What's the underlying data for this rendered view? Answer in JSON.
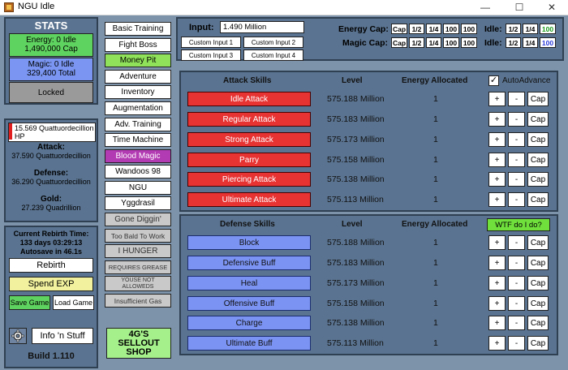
{
  "window": {
    "title": "NGU Idle",
    "minimize": "—",
    "maximize": "☐",
    "close": "✕"
  },
  "stats": {
    "header": "STATS",
    "energy_line1": "Energy: 0 Idle",
    "energy_line2": "1,490,000 Cap",
    "magic_line1": "Magic: 0 Idle",
    "magic_line2": "329,400 Total",
    "locked": "Locked",
    "hp_line1": "15.569 Quattuordecillion",
    "hp_line2": "HP",
    "attack_label": "Attack:",
    "attack_value": "37.590 Quattuordecillion",
    "defense_label": "Defense:",
    "defense_value": "36.290 Quattuordecillion",
    "gold_label": "Gold:",
    "gold_value": "27.239 Quadrillion",
    "rebirth_line1": "Current Rebirth Time:",
    "rebirth_line2": "133 days 03:29:13",
    "rebirth_line3": "Autosave in 46.1s",
    "rebirth_button": "Rebirth",
    "spend_exp": "Spend EXP",
    "save_game": "Save Game",
    "load_game": "Load Game",
    "info": "Info 'n Stuff",
    "build": "Build 1.110"
  },
  "menu": [
    {
      "label": "Basic Training",
      "style": "white"
    },
    {
      "label": "Fight Boss",
      "style": "white"
    },
    {
      "label": "Money Pit",
      "style": "green"
    },
    {
      "label": "Adventure",
      "style": "white"
    },
    {
      "label": "Inventory",
      "style": "white"
    },
    {
      "label": "Augmentation",
      "style": "white"
    },
    {
      "label": "Adv. Training",
      "style": "white"
    },
    {
      "label": "Time Machine",
      "style": "white"
    },
    {
      "label": "Blood Magic",
      "style": "purple"
    },
    {
      "label": "Wandoos 98",
      "style": "white"
    },
    {
      "label": "NGU",
      "style": "white"
    },
    {
      "label": "Yggdrasil",
      "style": "white"
    },
    {
      "label": "Gone Diggin'",
      "style": "gray"
    },
    {
      "label": "Too Bald To Work",
      "style": "gray"
    },
    {
      "label": "I HUNGER",
      "style": "gray"
    },
    {
      "label": "REQUIRES GREASE",
      "style": "gray"
    },
    {
      "label": "YOUSE NOT ALLOWEDS",
      "style": "gray"
    },
    {
      "label": "Insufficient Gas",
      "style": "gray"
    }
  ],
  "shop": {
    "line1": "4G'S",
    "line2": "SELLOUT",
    "line3": "SHOP"
  },
  "input": {
    "label": "Input:",
    "value": "1.490 Million",
    "custom1": "Custom Input 1",
    "custom2": "Custom Input 2",
    "custom3": "Custom Input 3",
    "custom4": "Custom Input 4"
  },
  "caps": {
    "energy_label": "Energy Cap:",
    "magic_label": "Magic Cap:",
    "cap": "Cap",
    "half": "1/2",
    "quarter": "1/4",
    "hundred": "100",
    "idle_label": "Idle:",
    "energy_idle_highlight": "100",
    "magic_idle_highlight": "100",
    "energy_idle_color": "#1a9a1a",
    "magic_idle_color": "#2a3ad8"
  },
  "attack": {
    "col_skill": "Attack Skills",
    "col_level": "Level",
    "col_energy": "Energy Allocated",
    "autoadvance": "AutoAdvance",
    "autoadvance_checked": true,
    "rows": [
      {
        "name": "Idle Attack",
        "level": "575.188 Million",
        "energy": "1"
      },
      {
        "name": "Regular Attack",
        "level": "575.183 Million",
        "energy": "1"
      },
      {
        "name": "Strong Attack",
        "level": "575.173 Million",
        "energy": "1"
      },
      {
        "name": "Parry",
        "level": "575.158 Million",
        "energy": "1"
      },
      {
        "name": "Piercing Attack",
        "level": "575.138 Million",
        "energy": "1"
      },
      {
        "name": "Ultimate Attack",
        "level": "575.113 Million",
        "energy": "1"
      }
    ]
  },
  "defense": {
    "col_skill": "Defense Skills",
    "col_level": "Level",
    "col_energy": "Energy Allocated",
    "help": "WTF do I do?",
    "rows": [
      {
        "name": "Block",
        "level": "575.188 Million",
        "energy": "1"
      },
      {
        "name": "Defensive Buff",
        "level": "575.183 Million",
        "energy": "1"
      },
      {
        "name": "Heal",
        "level": "575.173 Million",
        "energy": "1"
      },
      {
        "name": "Offensive Buff",
        "level": "575.158 Million",
        "energy": "1"
      },
      {
        "name": "Charge",
        "level": "575.138 Million",
        "energy": "1"
      },
      {
        "name": "Ultimate Buff",
        "level": "575.113 Million",
        "energy": "1"
      }
    ]
  },
  "row_buttons": {
    "plus": "+",
    "minus": "-",
    "cap": "Cap"
  }
}
